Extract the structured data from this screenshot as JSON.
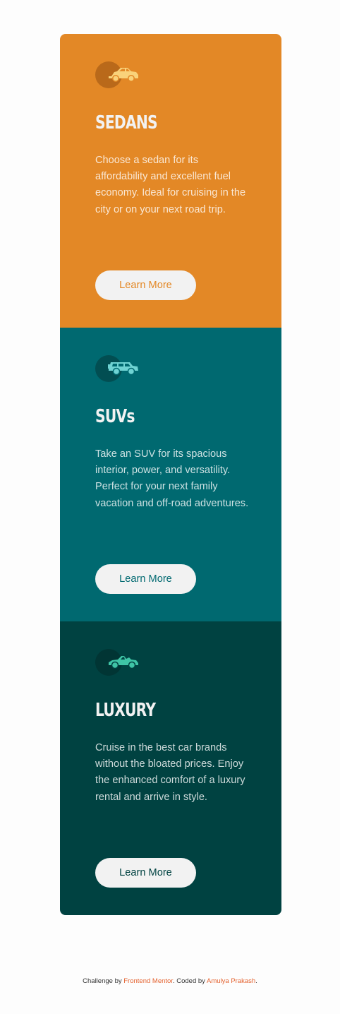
{
  "cards": [
    {
      "icon": "sedan-car-icon",
      "title": "Sedans",
      "text": "Choose a sedan for its affordability and excellent fuel economy. Ideal for cruising in the city or on your next road trip.",
      "button_label": "Learn More",
      "color": "#e38826"
    },
    {
      "icon": "suv-car-icon",
      "title": "SUVs",
      "text": "Take an SUV for its spacious interior, power, and versatility. Perfect for your next family vacation and off-road adventures.",
      "button_label": "Learn More",
      "color": "#006970"
    },
    {
      "icon": "luxury-car-icon",
      "title": "Luxury",
      "text": "Cruise in the best car brands without the bloated prices. Enjoy the enhanced comfort of a luxury rental and arrive in style.",
      "button_label": "Learn More",
      "color": "#004241"
    }
  ],
  "footer": {
    "prefix": "Challenge by ",
    "link1": "Frontend Mentor",
    "middle": ". Coded by ",
    "link2": "Amulya Prakash",
    "suffix": "."
  }
}
